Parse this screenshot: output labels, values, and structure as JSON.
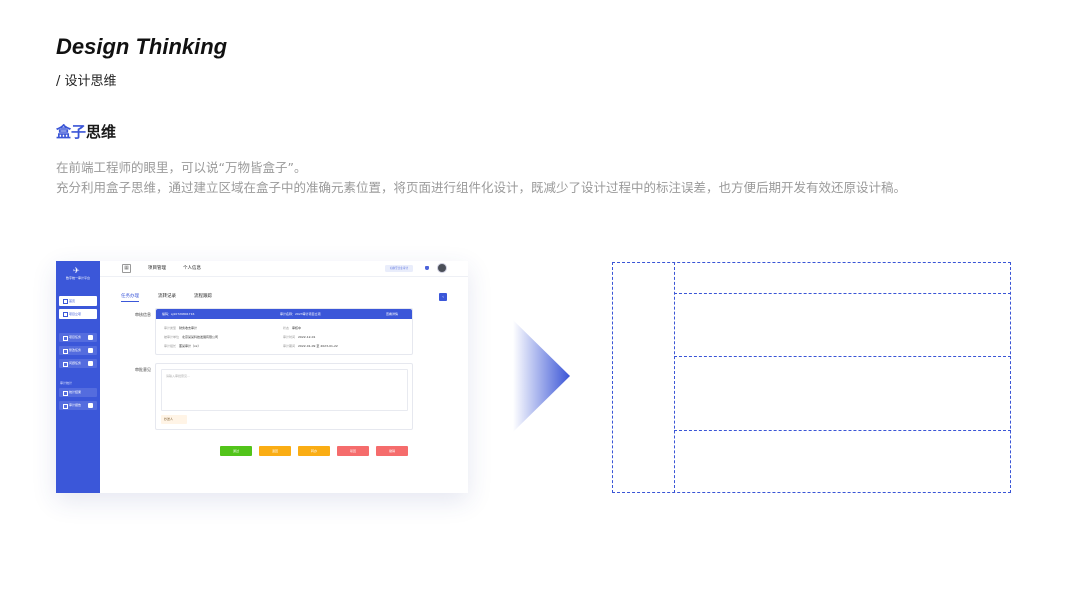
{
  "slide": {
    "title": "Design Thinking",
    "subtitle": "/ 设计思维",
    "heading_accent": "盒子",
    "heading_rest": "思维",
    "desc_line1": "在前端工程师的眼里，可以说“万物皆盒子”。",
    "desc_line2": "充分利用盒子思维，通过建立区域在盒子中的准确元素位置，将页面进行组件化设计，既减少了设计过程中的标注误差，也方便后期开发有效还原设计稿。"
  },
  "mockup": {
    "logo_text": "数字统一审计平台",
    "sidebar": {
      "home": "首页",
      "mine": "项目立项",
      "items": [
        "项目任务",
        "整改任务",
        "问题任务"
      ],
      "group_label": "审计统计",
      "items2": [
        "统计结果",
        "审计报告"
      ]
    },
    "topbar": {
      "nav": [
        "项目管理",
        "个人信息"
      ],
      "pill": "切换至企业审计",
      "grid_icon": "▦"
    },
    "tabs": [
      "任务办理",
      "流转记录",
      "流程跟踪"
    ],
    "corner_icon": "‹",
    "label_info": "审核信息",
    "label_opinion": "审批意见",
    "card": {
      "head_id": "编码：sj10729891716",
      "head_project": "审计名称：2023审计项目立项",
      "head_action": "查看详情",
      "rows": [
        {
          "k": "审计类型",
          "v": "财务收支审计"
        },
        {
          "k": "状态",
          "v": "审核中"
        },
        {
          "k": "被审计单位",
          "v": "北京某某科技发展有限公司"
        },
        {
          "k": "审计时间",
          "v": "2022-12-01"
        },
        {
          "k": "审计组长",
          "v": "董某审计（xx）"
        },
        {
          "k": "审计期间",
          "v": "2022-01-09 至 2023-01-22"
        }
      ]
    },
    "opinion_placeholder": "请输入审批意见...",
    "tag": "抄送人",
    "actions": [
      "通过",
      "退回",
      "转办",
      "驳回",
      "撤销"
    ]
  },
  "colors": {
    "accent": "#3a55d6",
    "approve": "#52c41a",
    "warn": "#faad14",
    "danger": "#f56c6c"
  }
}
